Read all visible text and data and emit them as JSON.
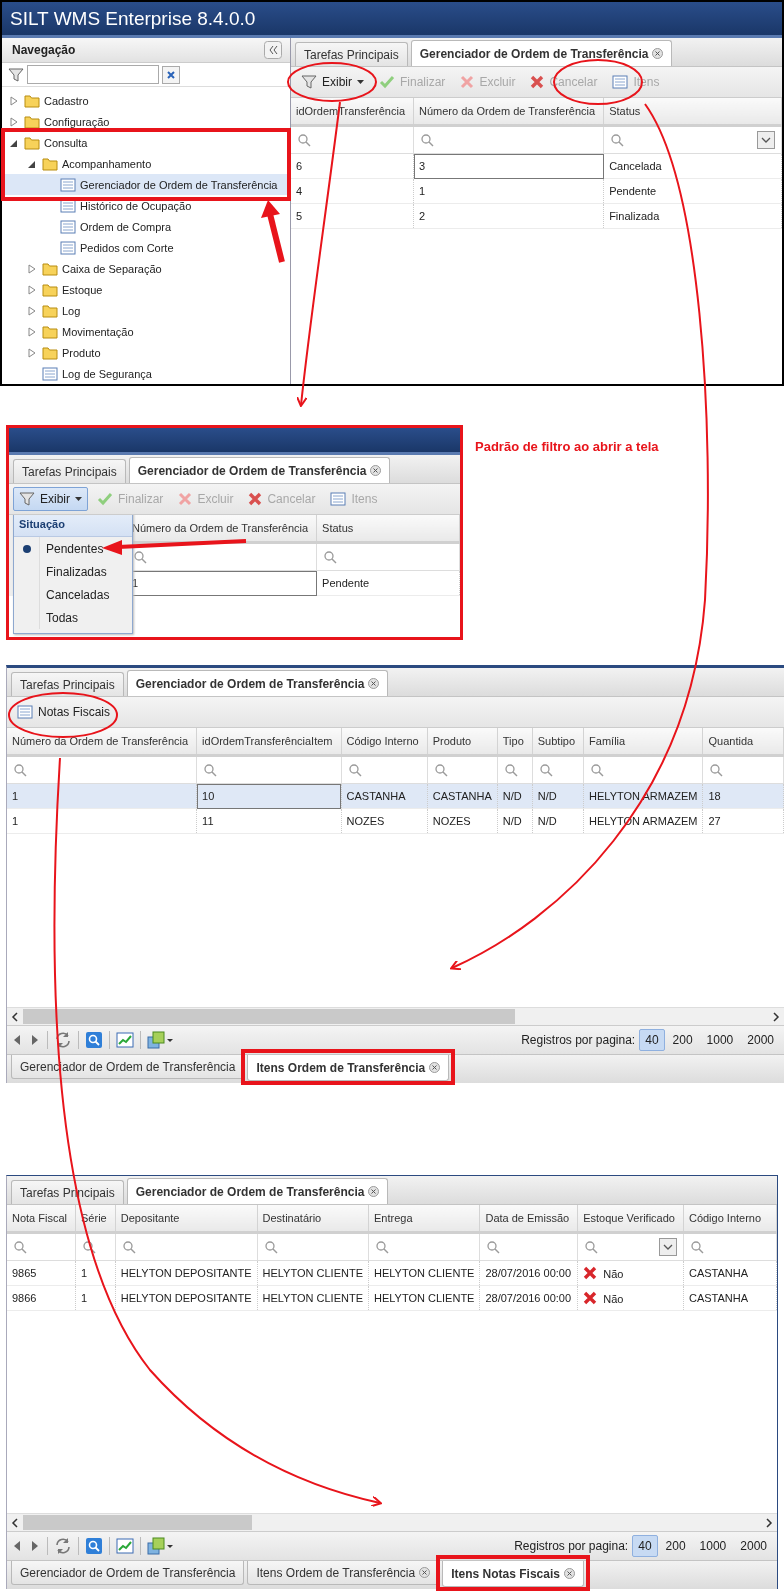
{
  "main_window": {
    "title": "SILT WMS Enterprise 8.4.0.0",
    "navigation": {
      "title": "Navegação",
      "tree": [
        {
          "label": "Cadastro",
          "kind": "folder",
          "expanded": false,
          "selected": false
        },
        {
          "label": "Configuração",
          "kind": "folder",
          "expanded": false,
          "selected": false
        },
        {
          "label": "Consulta",
          "kind": "folder",
          "expanded": true,
          "selected": false,
          "children": [
            {
              "label": "Acompanhamento",
              "kind": "folder",
              "expanded": true,
              "selected": false,
              "children": [
                {
                  "label": "Gerenciador de Ordem de Transferência",
                  "kind": "report",
                  "selected": true
                },
                {
                  "label": "Histórico de Ocupação",
                  "kind": "report",
                  "selected": false
                },
                {
                  "label": "Ordem de Compra",
                  "kind": "report",
                  "selected": false
                },
                {
                  "label": "Pedidos com Corte",
                  "kind": "report",
                  "selected": false
                }
              ]
            },
            {
              "label": "Caixa de Separação",
              "kind": "folder",
              "expanded": false,
              "selected": false
            },
            {
              "label": "Estoque",
              "kind": "folder",
              "expanded": false,
              "selected": false
            },
            {
              "label": "Log",
              "kind": "folder",
              "expanded": false,
              "selected": false
            },
            {
              "label": "Movimentação",
              "kind": "folder",
              "expanded": false,
              "selected": false
            },
            {
              "label": "Produto",
              "kind": "folder",
              "expanded": false,
              "selected": false
            },
            {
              "label": "Log de Segurança",
              "kind": "report",
              "selected": false
            }
          ]
        }
      ]
    },
    "workspace": {
      "tabs": [
        {
          "label": "Tarefas Principais",
          "selected": false,
          "closable": false
        },
        {
          "label": "Gerenciador de Ordem de Transferência",
          "selected": true,
          "closable": true
        }
      ],
      "toolbar": [
        {
          "label": "Exibir",
          "kind": "filter",
          "disabled": false,
          "dropdown": true,
          "pressed": false
        },
        {
          "label": "Finalizar",
          "kind": "check",
          "disabled": true,
          "dropdown": false,
          "pressed": false
        },
        {
          "label": "Excluir",
          "kind": "delete",
          "disabled": true,
          "dropdown": false,
          "pressed": false
        },
        {
          "label": "Cancelar",
          "kind": "cancel",
          "disabled": true,
          "dropdown": false,
          "pressed": false
        },
        {
          "label": "Itens",
          "kind": "list",
          "disabled": true,
          "dropdown": false,
          "pressed": false
        }
      ],
      "columns": [
        {
          "label": "idOrdemTransferência",
          "filter_dropdown": false
        },
        {
          "label": "Número da Ordem de Transferência",
          "filter_dropdown": false
        },
        {
          "label": "Status",
          "filter_dropdown": true
        }
      ],
      "rows": [
        {
          "selected": false,
          "cells": [
            "6",
            {
              "text": "3",
              "focused": true
            },
            "Cancelada"
          ]
        },
        {
          "selected": false,
          "cells": [
            "4",
            "1",
            "Pendente"
          ]
        },
        {
          "selected": false,
          "cells": [
            "5",
            "2",
            "Finalizada"
          ]
        }
      ]
    }
  },
  "filter_menu_window": {
    "caption": "Padrão de filtro ao abrir a tela",
    "workspace": {
      "tabs": [
        {
          "label": "Tarefas Principais",
          "selected": false,
          "closable": false
        },
        {
          "label": "Gerenciador de Ordem de Transferência",
          "selected": true,
          "closable": true
        }
      ],
      "toolbar": [
        {
          "label": "Exibir",
          "kind": "filter",
          "disabled": false,
          "dropdown": true,
          "pressed": true
        },
        {
          "label": "Finalizar",
          "kind": "check",
          "disabled": true,
          "dropdown": false,
          "pressed": false
        },
        {
          "label": "Excluir",
          "kind": "delete",
          "disabled": true,
          "dropdown": false,
          "pressed": false
        },
        {
          "label": "Cancelar",
          "kind": "cancel",
          "disabled": true,
          "dropdown": false,
          "pressed": false
        },
        {
          "label": "Itens",
          "kind": "list",
          "disabled": true,
          "dropdown": false,
          "pressed": false
        }
      ],
      "menu": {
        "title": "Situação",
        "items": [
          {
            "label": "Pendentes",
            "selected": true
          },
          {
            "label": "Finalizadas",
            "selected": false
          },
          {
            "label": "Canceladas",
            "selected": false
          },
          {
            "label": "Todas",
            "selected": false
          }
        ]
      },
      "columns": [
        {
          "label": "Número da Ordem de Transferência",
          "filter_dropdown": false
        },
        {
          "label": "Status",
          "filter_dropdown": false
        }
      ],
      "rows": [
        {
          "selected": false,
          "cells": [
            {
              "text": "1",
              "focused": true
            },
            "Pendente"
          ]
        }
      ]
    }
  },
  "items_window": {
    "workspace": {
      "tabs": [
        {
          "label": "Tarefas Principais",
          "selected": false,
          "closable": false
        },
        {
          "label": "Gerenciador de Ordem de Transferência",
          "selected": true,
          "closable": true
        }
      ],
      "toolbar": [
        {
          "label": "Notas Fiscais",
          "kind": "list",
          "disabled": false,
          "dropdown": false,
          "pressed": false
        }
      ],
      "columns": [
        {
          "label": "Número da Ordem de Transferência",
          "filter_dropdown": false
        },
        {
          "label": "idOrdemTransferênciaItem",
          "filter_dropdown": false
        },
        {
          "label": "Código Interno",
          "filter_dropdown": false
        },
        {
          "label": "Produto",
          "filter_dropdown": false
        },
        {
          "label": "Tipo",
          "filter_dropdown": false
        },
        {
          "label": "Subtipo",
          "filter_dropdown": false
        },
        {
          "label": "Família",
          "filter_dropdown": false
        },
        {
          "label": "Quantida",
          "filter_dropdown": false
        }
      ],
      "rows": [
        {
          "selected": true,
          "cells": [
            "1",
            {
              "text": "10",
              "focused": true
            },
            "CASTANHA",
            "CASTANHA",
            "N/D",
            "N/D",
            "HELYTON ARMAZEM",
            "18"
          ]
        },
        {
          "selected": false,
          "cells": [
            "1",
            "11",
            "NOZES",
            "NOZES",
            "N/D",
            "N/D",
            "HELYTON ARMAZEM",
            "27"
          ]
        }
      ],
      "paging": {
        "label": "Registros por pagina:",
        "options": [
          {
            "label": "40",
            "selected": true
          },
          {
            "label": "200",
            "selected": false
          },
          {
            "label": "1000",
            "selected": false
          },
          {
            "label": "2000",
            "selected": false
          }
        ]
      },
      "bottom_tabs": [
        {
          "label": "Gerenciador de Ordem de Transferência",
          "selected": false,
          "closable": false
        },
        {
          "label": "Itens Ordem de Transferência",
          "selected": true,
          "closable": true
        }
      ]
    }
  },
  "invoices_window": {
    "workspace": {
      "tabs": [
        {
          "label": "Tarefas Principais",
          "selected": false,
          "closable": false
        },
        {
          "label": "Gerenciador de Ordem de Transferência",
          "selected": true,
          "closable": true
        }
      ],
      "columns": [
        {
          "label": "Nota Fiscal",
          "filter_dropdown": false
        },
        {
          "label": "Série",
          "filter_dropdown": false
        },
        {
          "label": "Depositante",
          "filter_dropdown": false
        },
        {
          "label": "Destinatário",
          "filter_dropdown": false
        },
        {
          "label": "Entrega",
          "filter_dropdown": false
        },
        {
          "label": "Data de Emissão",
          "filter_dropdown": false
        },
        {
          "label": "Estoque Verificado",
          "filter_dropdown": true
        },
        {
          "label": "Código Interno",
          "filter_dropdown": false
        }
      ],
      "rows": [
        {
          "selected": false,
          "cells": [
            "9865",
            "1",
            "HELYTON DEPOSITANTE",
            "HELYTON CLIENTE",
            "HELYTON CLIENTE",
            "28/07/2016 00:00",
            {
              "text": "Não",
              "kind": "cross"
            },
            "CASTANHA"
          ]
        },
        {
          "selected": false,
          "cells": [
            "9866",
            "1",
            "HELYTON DEPOSITANTE",
            "HELYTON CLIENTE",
            "HELYTON CLIENTE",
            "28/07/2016 00:00",
            {
              "text": "Não",
              "kind": "cross"
            },
            "CASTANHA"
          ]
        }
      ],
      "paging": {
        "label": "Registros por pagina:",
        "options": [
          {
            "label": "40",
            "selected": true
          },
          {
            "label": "200",
            "selected": false
          },
          {
            "label": "1000",
            "selected": false
          },
          {
            "label": "2000",
            "selected": false
          }
        ]
      },
      "bottom_tabs": [
        {
          "label": "Gerenciador de Ordem de Transferência",
          "selected": false,
          "closable": false
        },
        {
          "label": "Itens Ordem de Transferência",
          "selected": false,
          "closable": true
        },
        {
          "label": "Itens Notas Fiscais",
          "selected": true,
          "closable": true
        }
      ]
    }
  }
}
